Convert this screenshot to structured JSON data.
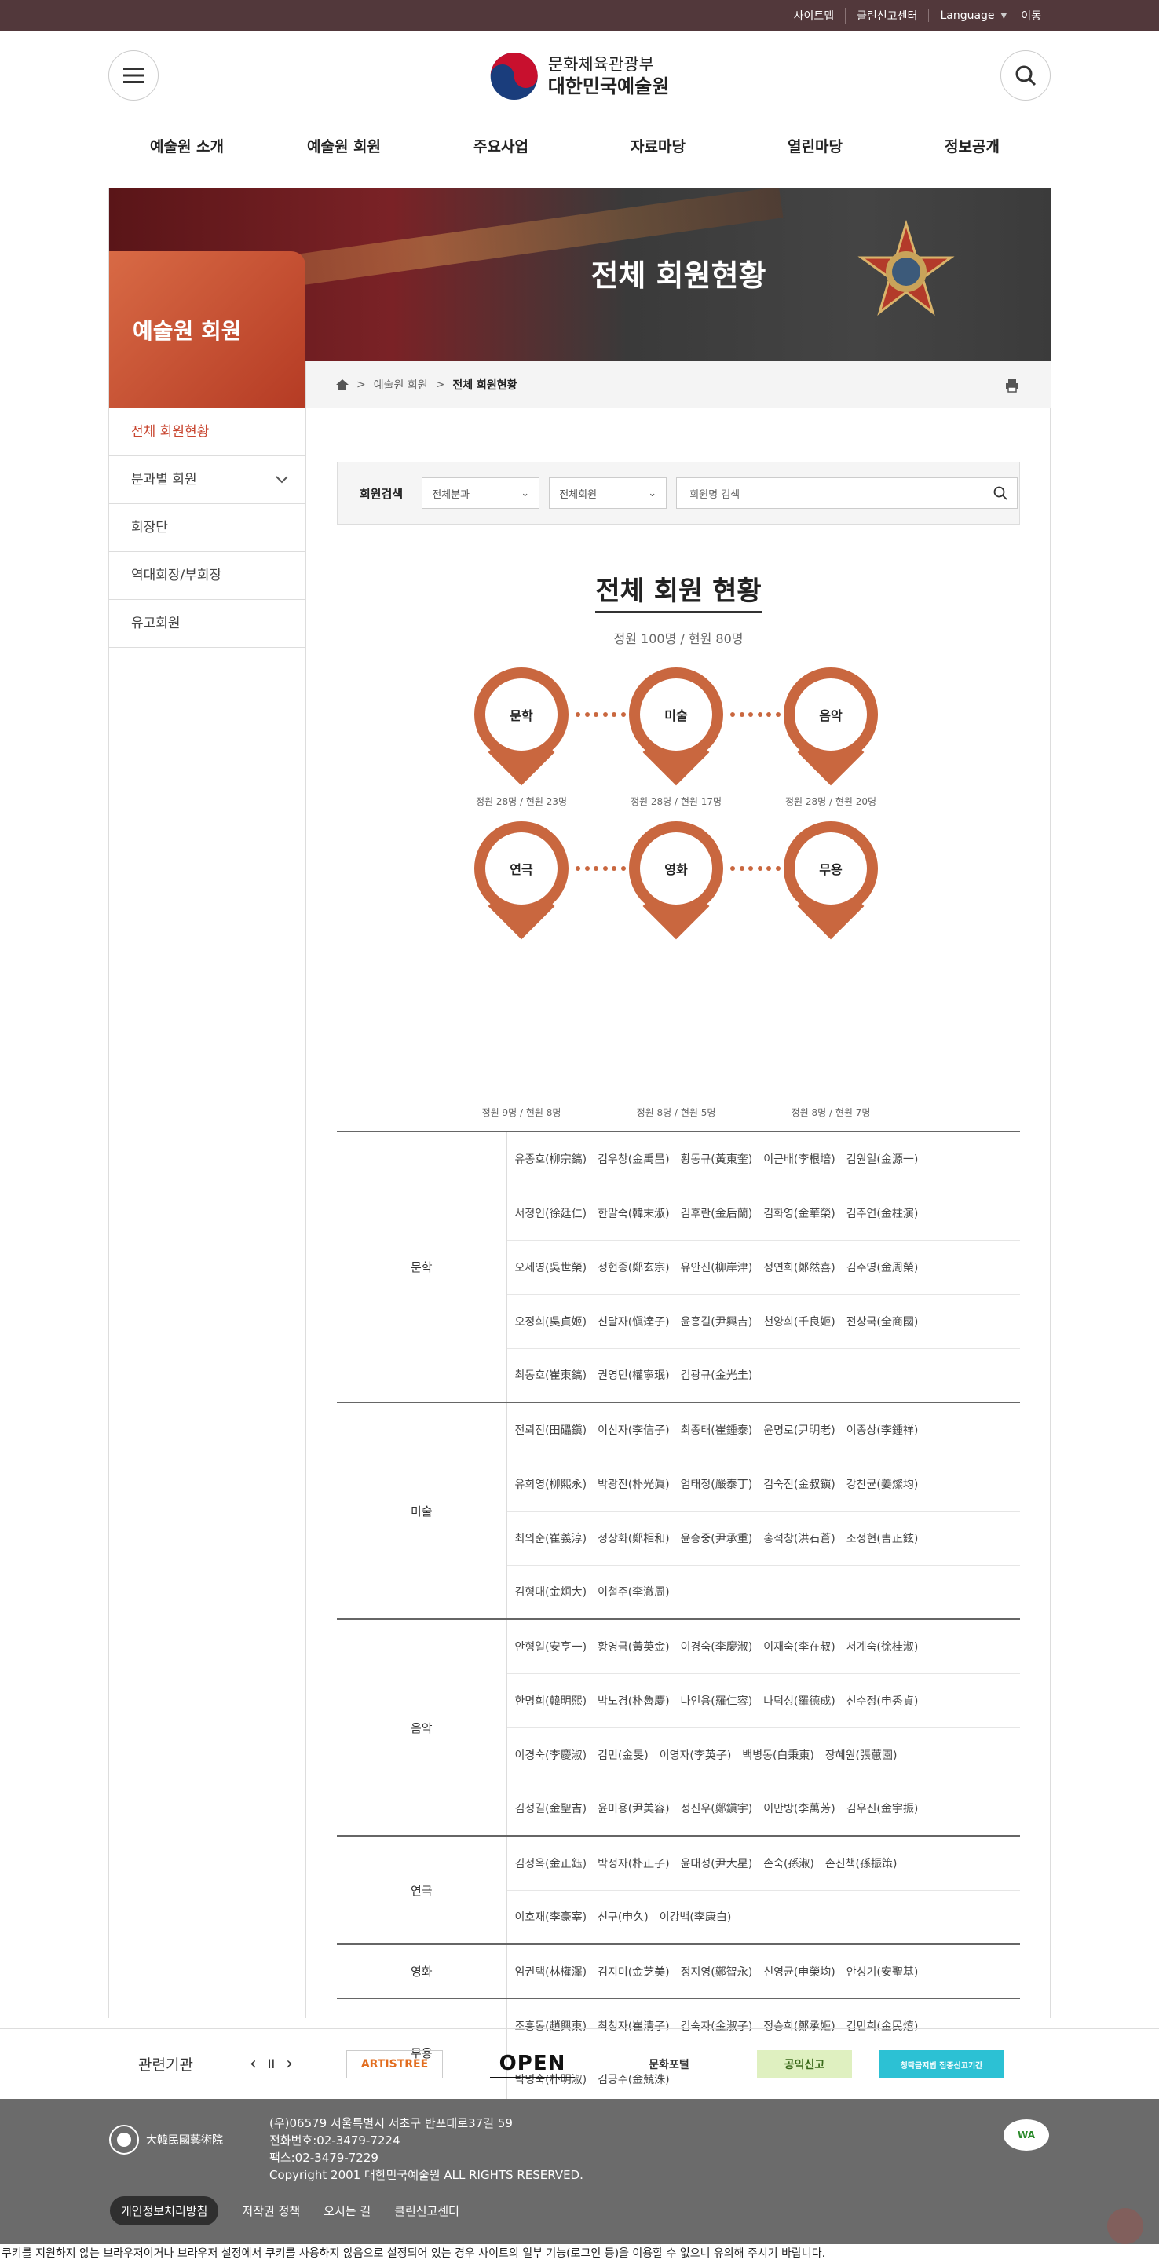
{
  "topbar": {
    "sitemap": "사이트맵",
    "clean": "클린신고센터",
    "language": "Language",
    "go": "이동"
  },
  "logo": {
    "line1": "문화체육관광부",
    "line2": "대한민국예술원"
  },
  "gnb": [
    "예술원 소개",
    "예술원 회원",
    "주요사업",
    "자료마당",
    "열린마당",
    "정보공개"
  ],
  "banner": {
    "title": "전체 회원현황"
  },
  "side": {
    "title": "예술원 회원",
    "menu": [
      "전체 회원현황",
      "분과별 회원",
      "회장단",
      "역대회장/부회장",
      "유고회원"
    ]
  },
  "breadcrumb": {
    "level1": "예술원 회원",
    "current": "전체 회원현황"
  },
  "search": {
    "label": "회원검색",
    "select1": "전체분과",
    "select2": "전체회원",
    "placeholder": "회원명 검색"
  },
  "summary": {
    "title": "전체 회원 현황",
    "quota": "정원 100명 / 현원 80명"
  },
  "divisions": [
    {
      "name": "문학",
      "cap": "정원 28명 / 현원 23명"
    },
    {
      "name": "미술",
      "cap": "정원 28명 / 현원 17명"
    },
    {
      "name": "음악",
      "cap": "정원 28명 / 현원 20명"
    },
    {
      "name": "연극",
      "cap": "정원 9명 / 현원 8명"
    },
    {
      "name": "영화",
      "cap": "정원 8명 / 현원 5명"
    },
    {
      "name": "무용",
      "cap": "정원 8명 / 현원 7명"
    }
  ],
  "members": [
    {
      "cat": "문학",
      "rows": [
        "유종호(柳宗鎬)　김우창(金禹昌)　황동규(黃東奎)　이근배(李根培)　김원일(金源一)",
        "서정인(徐廷仁)　한말숙(韓末淑)　김후란(金后蘭)　김화영(金華榮)　김주연(金柱演)",
        "오세영(吳世榮)　정현종(鄭玄宗)　유안진(柳岸津)　정연희(鄭然喜)　김주영(金周榮)",
        "오정희(吳貞姬)　신달자(愼達子)　윤흥길(尹興吉)　천양희(千良姬)　전상국(全商國)",
        "최동호(崔東鎬)　권영민(權寧珉)　김광규(金光圭)"
      ]
    },
    {
      "cat": "미술",
      "rows": [
        "전뢰진(田礧鎭)　이신자(李信子)　최종태(崔鍾泰)　윤명로(尹明老)　이종상(李鍾祥)",
        "유희영(柳熙永)　박광진(朴光眞)　엄태정(嚴泰丁)　김숙진(金叔鎭)　강찬균(姜燦均)",
        "최의순(崔義淳)　정상화(鄭相和)　윤승중(尹承重)　홍석창(洪石蒼)　조정현(曺正鉉)",
        "김형대(金炯大)　이철주(李澈周)"
      ]
    },
    {
      "cat": "음악",
      "rows": [
        "안형일(安亨一)　황영금(黃英金)　이경숙(李慶淑)　이재숙(李在叔)　서계숙(徐桂淑)",
        "한명희(韓明熙)　박노경(朴魯慶)　나인용(羅仁容)　나덕성(羅德成)　신수정(申秀貞)",
        "이경숙(李慶淑)　김민(金旻)　이영자(李英子)　백병동(白秉東)　장혜원(張蕙園)",
        "김성길(金聖吉)　윤미용(尹美容)　정진우(鄭鎭宇)　이만방(李萬芳)　김우진(金宇振)"
      ]
    },
    {
      "cat": "연극",
      "rows": [
        "김정옥(金正鈺)　박정자(朴正子)　윤대성(尹大星)　손숙(孫淑)　손진책(孫振策)",
        "이호재(李豪宰)　신구(申久)　이강백(李康白)"
      ]
    },
    {
      "cat": "영화",
      "rows": [
        "임권택(林權澤)　김지미(金芝美)　정지영(鄭智永)　신영균(申榮均)　안성기(安聖基)"
      ]
    },
    {
      "cat": "무용",
      "rows": [
        "조흥동(趙興東)　최청자(崔淸子)　김숙자(金淑子)　정승희(鄭承姬)　김민희(金民熺)",
        "박명숙(朴明淑)　김긍수(金兢洙)"
      ]
    }
  ],
  "related": {
    "label": "관련기관",
    "prev": "‹",
    "pause": "II",
    "next": "›",
    "banners": [
      "ARTISTREE",
      "OPEN",
      "문화포털",
      "공익신고",
      "청탁금지법 집중신고기간"
    ]
  },
  "footer": {
    "logo": "大韓民國藝術院",
    "address": "(우)06579 서울특별시 서초구 반포대로37길 59",
    "tel": "전화번호:02-3479-7224",
    "fax": "팩스:02-3479-7229",
    "copyright": "Copyright 2001 대한민국예술원 ALL RIGHTS RESERVED.",
    "wa": "WA",
    "links": [
      "개인정보처리방침",
      "저작권 정책",
      "오시는 길",
      "클린신고센터"
    ]
  },
  "cookie": "쿠키를 지원하지 않는 브라우저이거나 브라우저 설정에서 쿠키를 사용하지 않음으로 설정되어 있는 경우 사이트의 일부 기능(로그인 등)을 이용할 수 없으니 유의해 주시기 바랍니다.",
  "colors": {
    "accent": "#c9673f",
    "topbar": "#52383b",
    "footer": "#6b6b6b"
  }
}
